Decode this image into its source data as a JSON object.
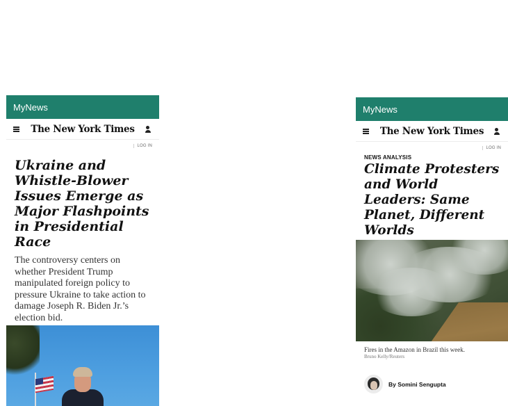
{
  "left_phone": {
    "app_title": "MyNews",
    "logo": "The New York Times",
    "login": "LOG IN",
    "headline": "Ukraine and Whistle-Blower Issues Emerge as Major Flashpoints in Presidential Race",
    "summary": "The controversy centers on whether President Trump manipulated foreign policy to pressure Ukraine to take action to damage Joseph R. Biden Jr.’s election bid."
  },
  "right_phone": {
    "app_title": "MyNews",
    "logo": "The New York Times",
    "login": "LOG IN",
    "kicker": "NEWS ANALYSIS",
    "headline": "Climate Protesters and World Leaders: Same Planet, Different Worlds",
    "caption": "Fires in the Amazon in Brazil this week.",
    "credit": "Bruno Kelly/Reuters",
    "byline": "By Somini Sengupta"
  },
  "colors": {
    "app_bar": "#1f7f6c"
  }
}
